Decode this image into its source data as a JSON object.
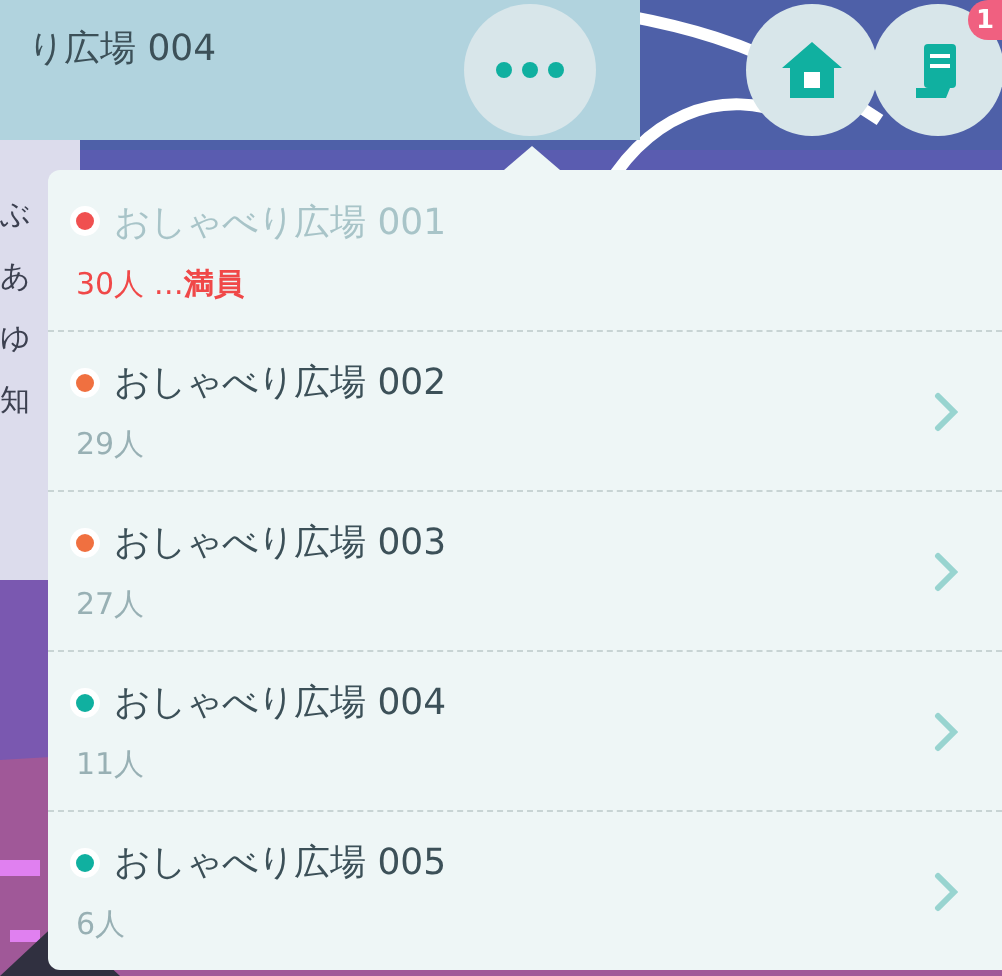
{
  "header": {
    "title": "り広場 004",
    "badge": "1"
  },
  "side_names": [
    "ぶ",
    "あ",
    "ゆ",
    "知"
  ],
  "rooms": [
    {
      "name": "おしゃべり広場 001",
      "count": "30人 …**満員**",
      "color": "#f05050",
      "disabled": true
    },
    {
      "name": "おしゃべり広場 002",
      "count": "29人",
      "color": "#f07040",
      "disabled": false
    },
    {
      "name": "おしゃべり広場 003",
      "count": "27人",
      "color": "#f07040",
      "disabled": false
    },
    {
      "name": "おしゃべり広場 004",
      "count": "11人",
      "color": "#10b0a0",
      "disabled": false
    },
    {
      "name": "おしゃべり広場 005",
      "count": "6人",
      "color": "#10b0a0",
      "disabled": false
    }
  ]
}
